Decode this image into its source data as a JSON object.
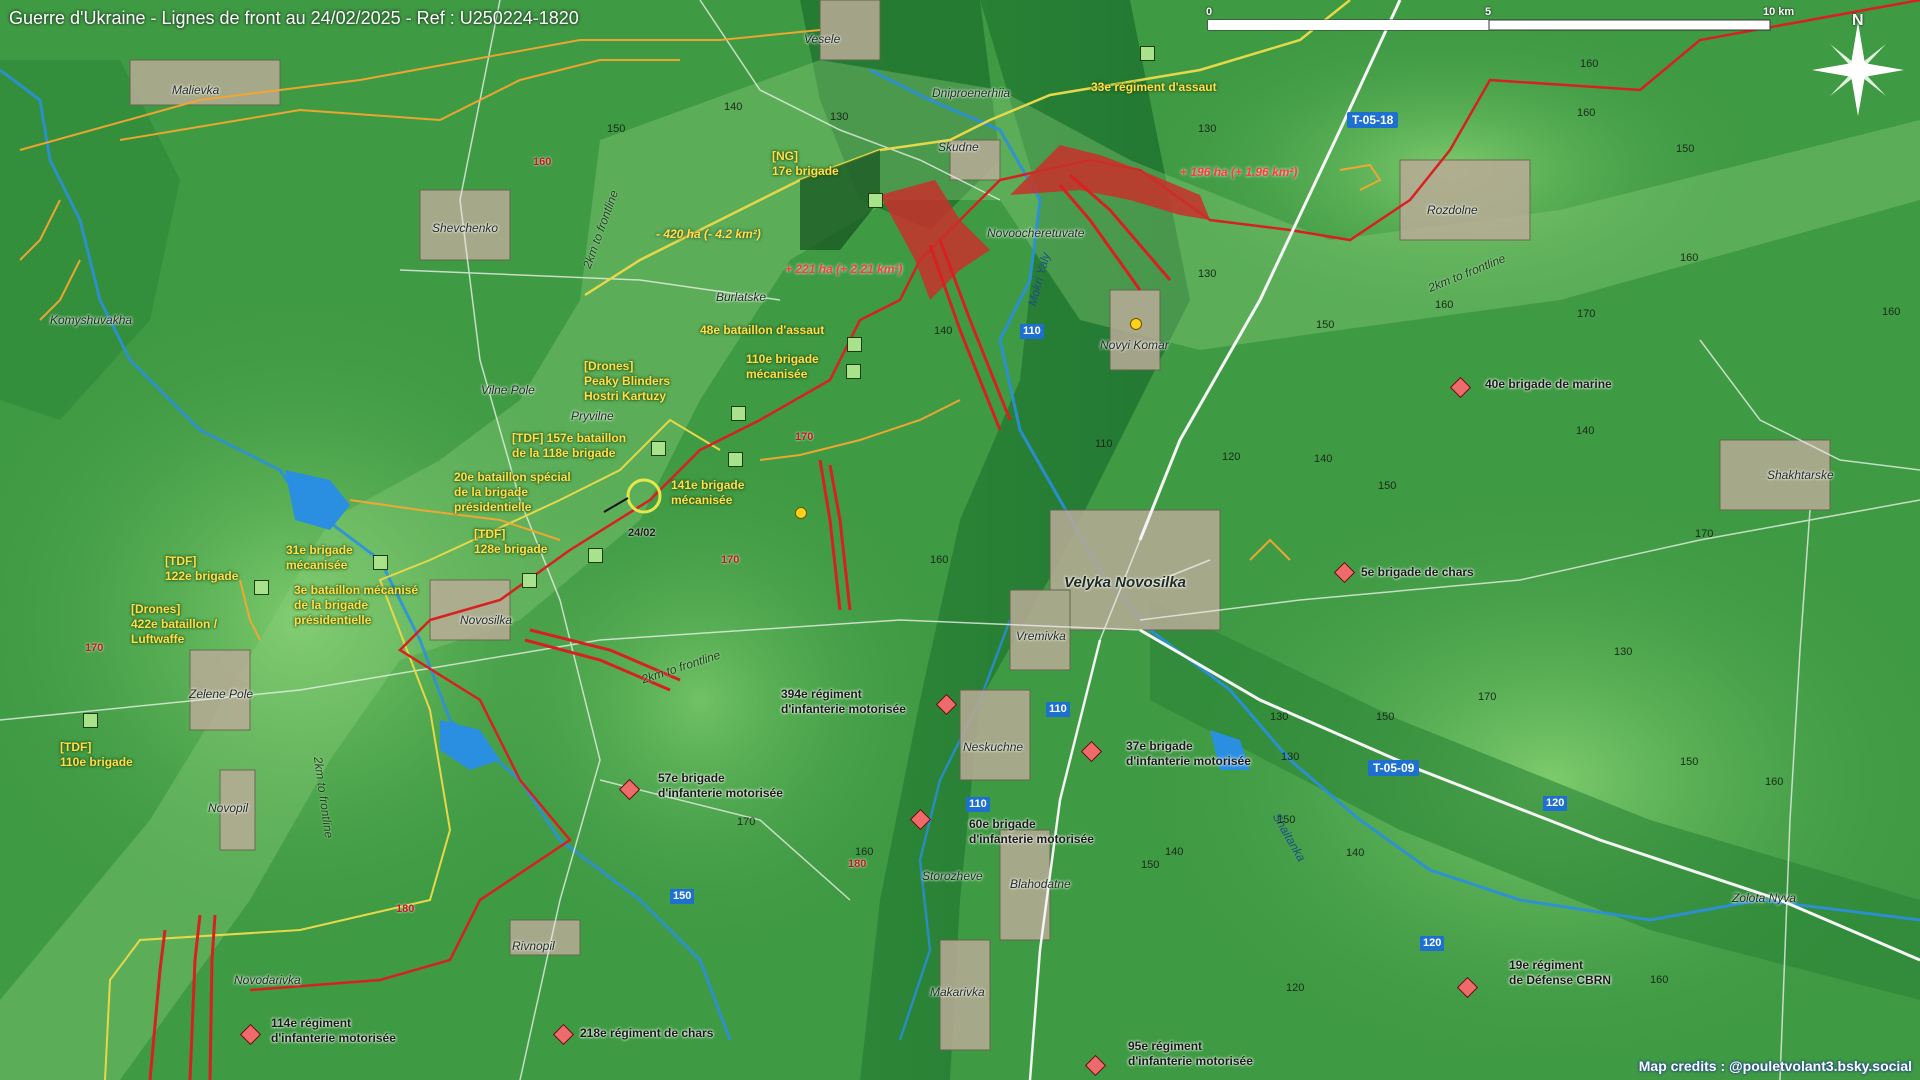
{
  "title": "Guerre d'Ukraine - Lignes de front au 24/02/2025 - Ref : U250224-1820",
  "credits": "Map credits : @pouletvolant3.bsky.social",
  "scale_bar": {
    "labels": [
      "0",
      "5",
      "10 km"
    ]
  },
  "north_label": "N",
  "places": {
    "vesele": "Vesele",
    "malievka": "Malievka",
    "dniproenerhiia": "Dniproenerhiia",
    "skudne": "Skudne",
    "shevchenko": "Shevchenko",
    "novoocheretuvate": "Novoocheretuvate",
    "burlatske": "Burlatske",
    "komyshuvakha": "Komyshuvakha",
    "rozdolne": "Rozdolne",
    "novyi_komar": "Novyi Komar",
    "vilne_pole": "Vilne Pole",
    "pryvilne": "Pryvilne",
    "velyka_novosilka": "Velyka Novosilka",
    "shakhtarske": "Shakhtarske",
    "vremivka": "Vremivka",
    "novosilka": "Novosilka",
    "zelene_pole": "Zelene Pole",
    "neskuchne": "Neskuchne",
    "novopil": "Novopil",
    "storozheve": "Storozheve",
    "blahodatne": "Blahodatne",
    "zolota_nyva": "Zolota Nyva",
    "rivnopil": "Rivnopil",
    "novodarivka": "Novodarivka",
    "makarivka": "Makarivka"
  },
  "rivers": {
    "mokri_yaly": "Mokri Yaly",
    "shaitanka": "Shaitanka"
  },
  "roads": {
    "t0518": "T-05-18",
    "t0509": "T-05-09",
    "r110a": "110",
    "r110b": "110",
    "r110c": "110",
    "r120": "120",
    "r120b": "120",
    "r150": "150"
  },
  "frontline_labels": [
    "2km to frontline",
    "2km to frontline",
    "2km to frontline",
    "2km to frontline"
  ],
  "elevations": {
    "black": [
      "130",
      "140",
      "150",
      "160",
      "150",
      "140",
      "130",
      "160",
      "150",
      "160",
      "170",
      "170",
      "160",
      "160",
      "150",
      "140",
      "130",
      "110",
      "120",
      "140",
      "150",
      "170",
      "160",
      "150",
      "170",
      "130",
      "140",
      "160",
      "150",
      "120",
      "160",
      "130",
      "140",
      "160",
      "130",
      "150"
    ],
    "red": [
      "160",
      "170",
      "170",
      "170",
      "180",
      "180"
    ]
  },
  "gains": [
    "+ 196 ha (+ 1.96 km²)",
    "+ 221 ha (+ 2.21 km²)"
  ],
  "losses": [
    "- 420 ha (- 4.2 km²)"
  ],
  "date_marker": "24/02",
  "ua_units": [
    "33e régiment d'assaut",
    "[NG]\n17e brigade",
    "48e bataillon d'assaut",
    "110e brigade\nmécanisée",
    "[Drones]\nPeaky Blinders\nHostri Kartuzy",
    "[TDF] 157e bataillon\nde la 118e brigade",
    "20e bataillon spécial\nde la brigade\nprésidentielle",
    "141e brigade\nmécanisée",
    "[TDF]\n128e brigade",
    "31e brigade\nmécanisée",
    "3e bataillon mécanisé\nde la brigade\nprésidentielle",
    "[TDF]\n122e brigade",
    "[Drones]\n422e bataillon /\nLuftwaffe",
    "[TDF]\n110e brigade"
  ],
  "ru_units": [
    "40e brigade de marine",
    "5e brigade de chars",
    "394e régiment\nd'infanterie motorisée",
    "37e brigade\nd'infanterie motorisée",
    "57e brigade\nd'infanterie motorisée",
    "60e brigade\nd'infanterie motorisée",
    "19e régiment\nde Défense CBRN",
    "114e régiment\nd'infanterie motorisée",
    "218e régiment de chars",
    "95e régiment\nd'infanterie motorisée"
  ],
  "colors": {
    "terrain_low": "#1f7a34",
    "terrain_mid": "#3f9a44",
    "terrain_high": "#6dc262",
    "ru_gain": "#c9302c",
    "ua_line": "#e7d84a",
    "ru_line": "#d82020",
    "roads": "#f0f0f0",
    "river": "#2a8fe0"
  }
}
